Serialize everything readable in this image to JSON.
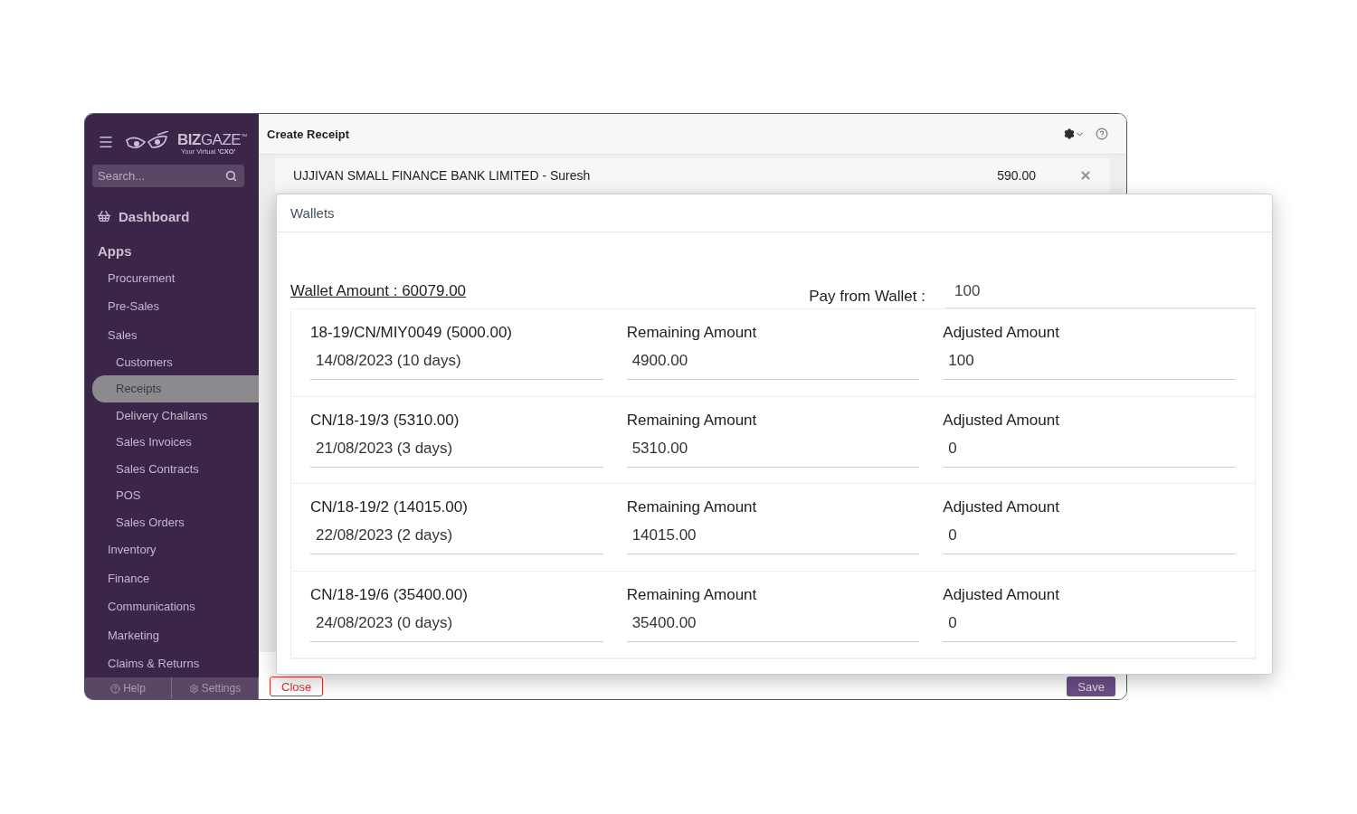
{
  "sidebar": {
    "brand": "**BIZ**GAZE$^{™}$",
    "tagline": "Your Virtual **'CXO'**",
    "search": {
      "placeholder": "Search..."
    },
    "dashboard": "Dashboard",
    "section": "Apps",
    "items": [
      {
        "label": "Procurement",
        "selected": false
      },
      {
        "label": "Pre-Sales",
        "selected": false
      },
      {
        "label": "Sales",
        "selected": false,
        "children": [
          {
            "label": "Customers",
            "selected": false
          },
          {
            "label": "Receipts",
            "selected": true
          },
          {
            "label": "Delivery Challans",
            "selected": false
          },
          {
            "label": "Sales Invoices",
            "selected": false
          },
          {
            "label": "Sales Contracts",
            "selected": false
          },
          {
            "label": "POS",
            "selected": false
          },
          {
            "label": "Sales Orders",
            "selected": false
          }
        ]
      },
      {
        "label": "Inventory",
        "selected": false
      },
      {
        "label": "Finance",
        "selected": false
      },
      {
        "label": "Communications",
        "selected": false
      },
      {
        "label": "Marketing",
        "selected": false
      },
      {
        "label": "Claims & Returns",
        "selected": false
      }
    ],
    "footer": [
      "Help",
      "Settings"
    ]
  },
  "window": {
    "title": "Create Receipt"
  },
  "customer": {
    "name": "UJJIVAN SMALL FINANCE BANK LIMITED - Suresh",
    "amount": "590.00"
  },
  "buttons": {
    "close": "Close",
    "save": "Save"
  },
  "modal": {
    "title": "Wallets",
    "wallet_amount": "Wallet Amount : 60079.00",
    "pay_label": "Pay from Wallet :",
    "pay_value": "100",
    "rows": [
      {
        "ref": "18-19/CN/MIY0049 (5000.00)",
        "date": "14/08/2023 (10 days)",
        "remaining_label": "Remaining Amount",
        "remaining": "4900.00",
        "adjusted_label": "Adjusted Amount",
        "adjusted": "100"
      },
      {
        "ref": "CN/18-19/3 (5310.00)",
        "date": "21/08/2023 (3 days)",
        "remaining_label": "Remaining Amount",
        "remaining": "5310.00",
        "adjusted_label": "Adjusted Amount",
        "adjusted": "0"
      },
      {
        "ref": "CN/18-19/2 (14015.00)",
        "date": "22/08/2023 (2 days)",
        "remaining_label": "Remaining Amount",
        "remaining": "14015.00",
        "adjusted_label": "Adjusted Amount",
        "adjusted": "0"
      },
      {
        "ref": "CN/18-19/6 (35400.00)",
        "date": "24/08/2023 (0 days)",
        "remaining_label": "Remaining Amount",
        "remaining": "35400.00",
        "adjusted_label": "Adjusted Amount",
        "adjusted": "0"
      }
    ]
  }
}
